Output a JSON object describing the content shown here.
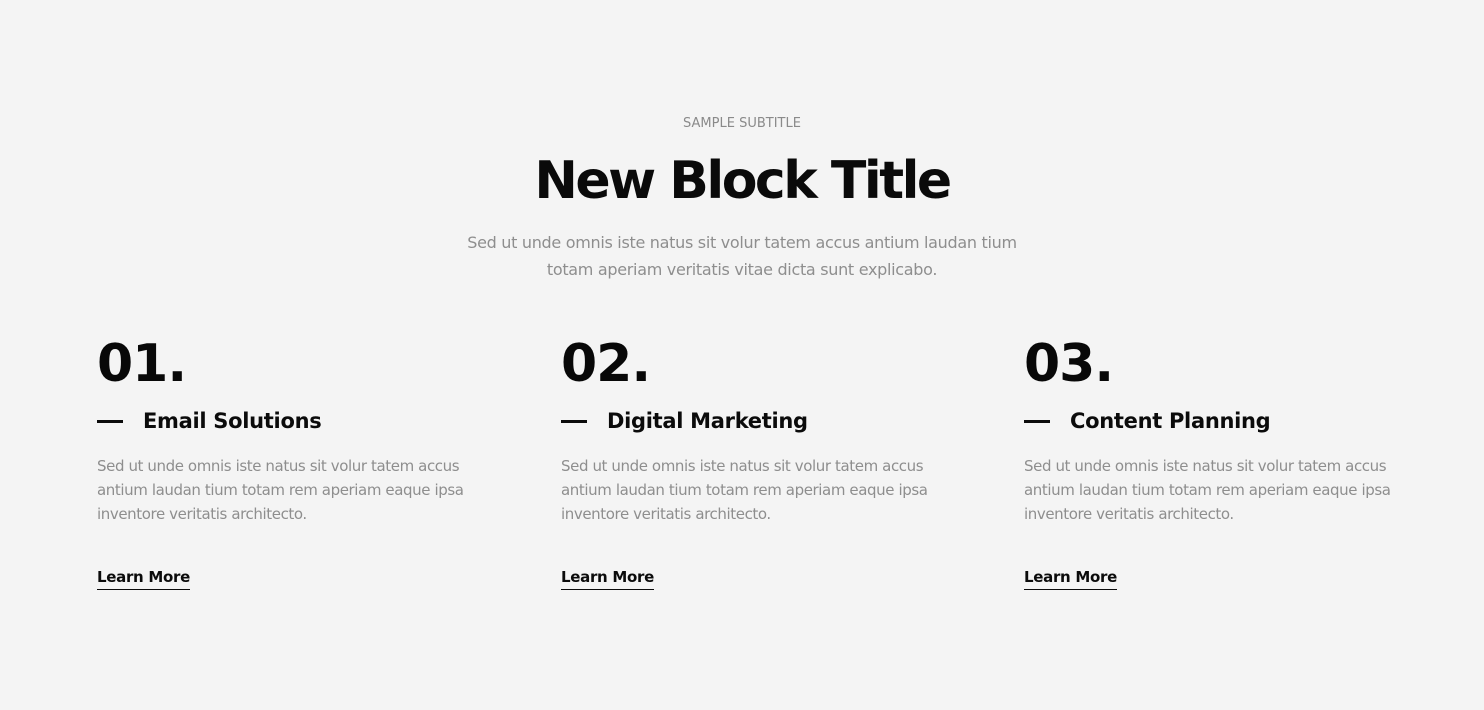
{
  "header": {
    "subtitle": "SAMPLE SUBTITLE",
    "title": "New Block Title",
    "lead": "Sed ut unde omnis iste natus sit volur tatem accus antium laudan tium totam aperiam veritatis vitae dicta sunt explicabo."
  },
  "features": [
    {
      "number": "01.",
      "title": "Email Solutions",
      "text": "Sed ut unde omnis iste natus sit volur tatem accus antium laudan tium totam rem aperiam eaque ipsa inventore veritatis architecto.",
      "link": "Learn More"
    },
    {
      "number": "02.",
      "title": "Digital Marketing",
      "text": "Sed ut unde omnis iste natus sit volur tatem accus antium laudan tium totam rem aperiam eaque ipsa inventore veritatis architecto.",
      "link": "Learn More"
    },
    {
      "number": "03.",
      "title": "Content Planning",
      "text": "Sed ut unde omnis iste natus sit volur tatem accus antium laudan tium totam rem aperiam eaque ipsa inventore veritatis architecto.",
      "link": "Learn More"
    }
  ],
  "colors": {
    "background": "#f4f4f4",
    "heading": "#0b0b0b",
    "muted_text": "#8e8e8e"
  }
}
